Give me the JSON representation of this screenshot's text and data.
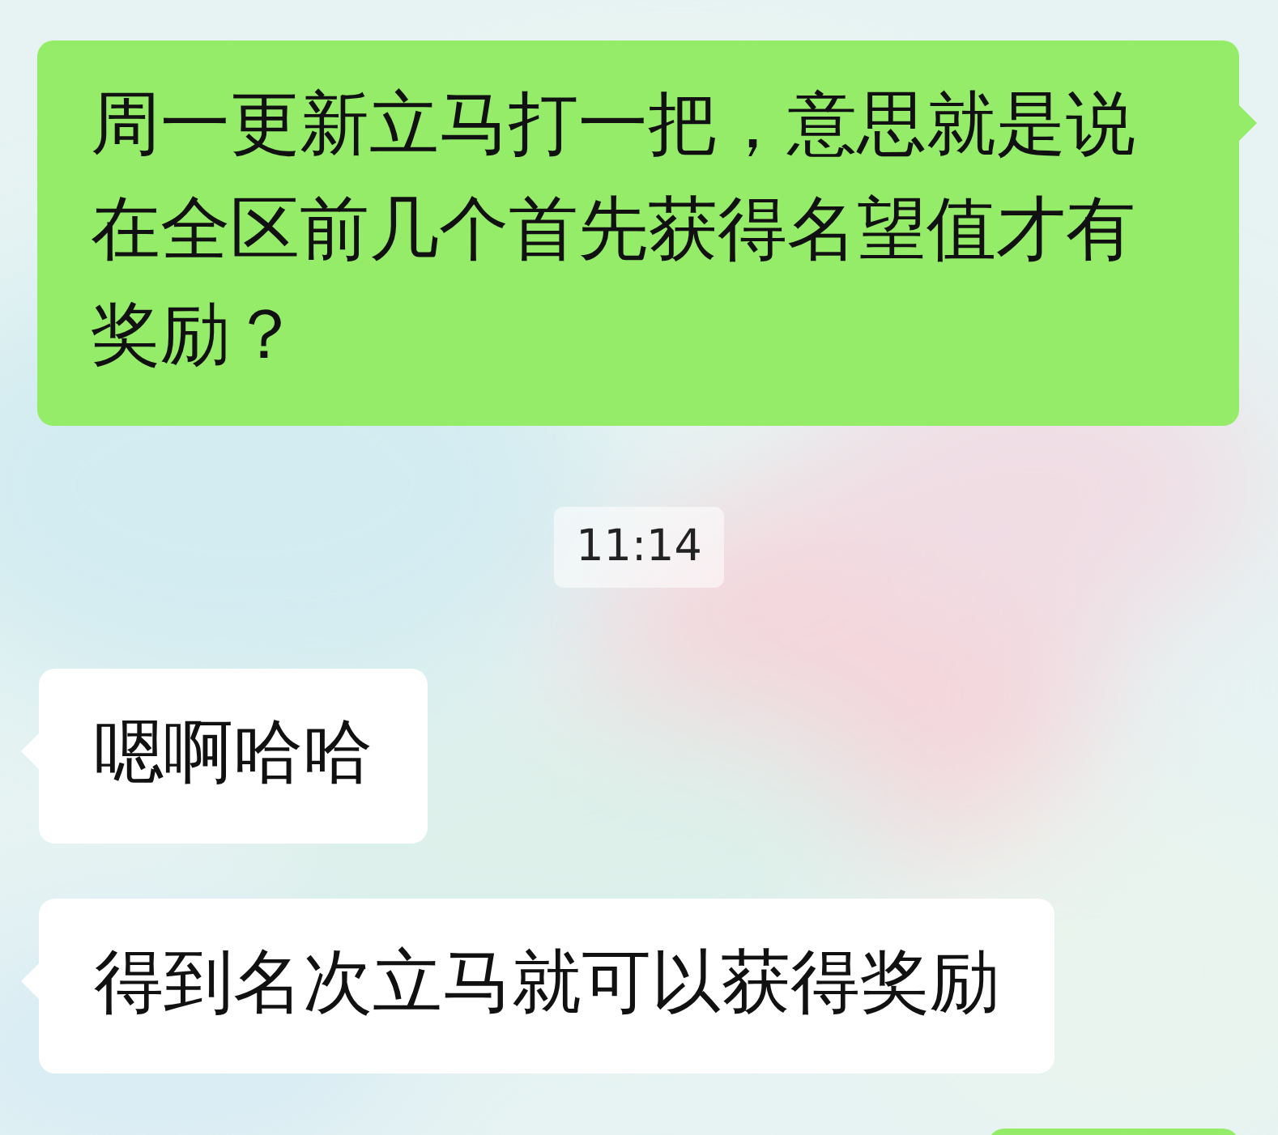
{
  "messages": [
    {
      "kind": "out",
      "text": "周一更新立马打一把，意思就是说在全区前几个首先获得名望值才有奖励？"
    },
    {
      "kind": "time",
      "text": "11:14"
    },
    {
      "kind": "in",
      "text": "嗯啊哈哈"
    },
    {
      "kind": "in",
      "text": "得到名次立马就可以获得奖励"
    },
    {
      "kind": "out"
    }
  ]
}
